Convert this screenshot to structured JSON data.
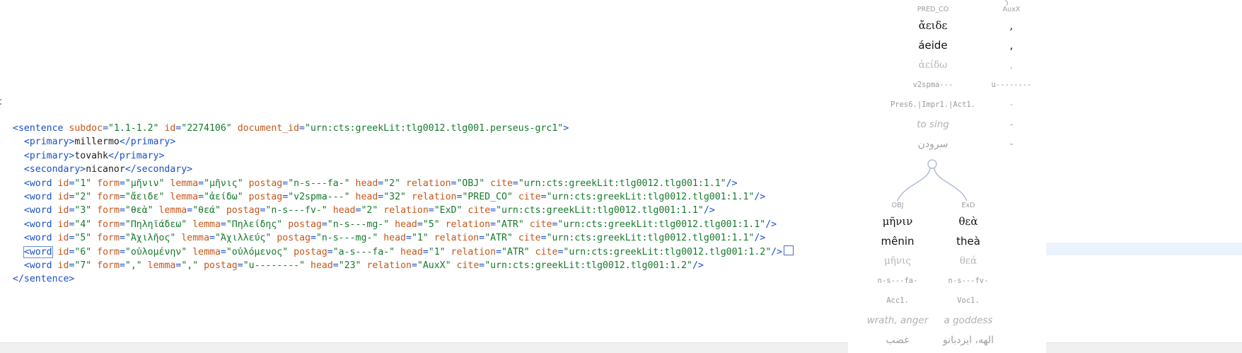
{
  "xml": {
    "sentence_open": {
      "tag": "sentence",
      "attrs": [
        [
          "subdoc",
          "1.1-1.2"
        ],
        [
          "id",
          "2274106"
        ],
        [
          "document_id",
          "urn:cts:greekLit:tlg0012.tlg001.perseus-grc1"
        ]
      ]
    },
    "primary": [
      "millermo",
      "tovahk"
    ],
    "secondary": [
      "nicanor"
    ],
    "tags": {
      "primary": "primary",
      "secondary": "secondary",
      "word": "word",
      "sentence": "sentence"
    },
    "words": [
      [
        [
          "id",
          "1"
        ],
        [
          "form",
          "μῆνιν"
        ],
        [
          "lemma",
          "μῆνις"
        ],
        [
          "postag",
          "n-s---fa-"
        ],
        [
          "head",
          "2"
        ],
        [
          "relation",
          "OBJ"
        ],
        [
          "cite",
          "urn:cts:greekLit:tlg0012.tlg001:1.1"
        ]
      ],
      [
        [
          "id",
          "2"
        ],
        [
          "form",
          "ἄειδε"
        ],
        [
          "lemma",
          "ἀείδω"
        ],
        [
          "postag",
          "v2spma---"
        ],
        [
          "head",
          "32"
        ],
        [
          "relation",
          "PRED_CO"
        ],
        [
          "cite",
          "urn:cts:greekLit:tlg0012.tlg001:1.1"
        ]
      ],
      [
        [
          "id",
          "3"
        ],
        [
          "form",
          "θεὰ"
        ],
        [
          "lemma",
          "θεά"
        ],
        [
          "postag",
          "n-s---fv-"
        ],
        [
          "head",
          "2"
        ],
        [
          "relation",
          "ExD"
        ],
        [
          "cite",
          "urn:cts:greekLit:tlg0012.tlg001:1.1"
        ]
      ],
      [
        [
          "id",
          "4"
        ],
        [
          "form",
          "Πηληϊάδεω"
        ],
        [
          "lemma",
          "Πηλείδης"
        ],
        [
          "postag",
          "n-s---mg-"
        ],
        [
          "head",
          "5"
        ],
        [
          "relation",
          "ATR"
        ],
        [
          "cite",
          "urn:cts:greekLit:tlg0012.tlg001:1.1"
        ]
      ],
      [
        [
          "id",
          "5"
        ],
        [
          "form",
          "Ἀχιλῆος"
        ],
        [
          "lemma",
          "Ἀχιλλεύς"
        ],
        [
          "postag",
          "n-s---mg-"
        ],
        [
          "head",
          "1"
        ],
        [
          "relation",
          "ATR"
        ],
        [
          "cite",
          "urn:cts:greekLit:tlg0012.tlg001:1.1"
        ]
      ],
      [
        [
          "id",
          "6"
        ],
        [
          "form",
          "οὐλομένην"
        ],
        [
          "lemma",
          "οὐλόμενος"
        ],
        [
          "postag",
          "a-s---fa-"
        ],
        [
          "head",
          "1"
        ],
        [
          "relation",
          "ATR"
        ],
        [
          "cite",
          "urn:cts:greekLit:tlg0012.tlg001:1.2"
        ]
      ],
      [
        [
          "id",
          "7"
        ],
        [
          "form",
          ","
        ],
        [
          "lemma",
          ","
        ],
        [
          "postag",
          "u--------"
        ],
        [
          "head",
          "23"
        ],
        [
          "relation",
          "AuxX"
        ],
        [
          "cite",
          "urn:cts:greekLit:tlg0012.tlg001:1.2"
        ]
      ]
    ],
    "bottom_fragment": "1.2\"/"
  },
  "tree": {
    "top_nodes": [
      {
        "rel": "PRED_CO",
        "form": "ἄειδε",
        "translit": "áeide",
        "lemma": "ἀείδω",
        "postag": "v2spma---",
        "morph": "Pres6.|Impr1.|Act1.",
        "gloss": "to sing",
        "farsi": "سرودن"
      },
      {
        "rel": "AuxX",
        "form": ",",
        "translit": ",",
        "lemma": ",",
        "postag": "u--------",
        "morph": "-",
        "gloss": "-",
        "farsi": "-"
      }
    ],
    "bottom_nodes": [
      {
        "rel": "OBJ",
        "form": "μῆνιν",
        "translit": "mênin",
        "lemma": "μῆνις",
        "postag": "n-s---fa-",
        "morph": "Acc1.",
        "gloss": "wrath, anger",
        "farsi": "غضب"
      },
      {
        "rel": "ExD",
        "form": "θεὰ",
        "translit": "theà",
        "lemma": "θεά",
        "postag": "n-s---fv-",
        "morph": "Voc1.",
        "gloss": "a goddess",
        "farsi": "الهه، ایزدبانو"
      }
    ]
  },
  "colors": {
    "tag": "#1a4fc7",
    "attr": "#c4571b",
    "value": "#157a2c",
    "edge": "#a9b4d6"
  }
}
